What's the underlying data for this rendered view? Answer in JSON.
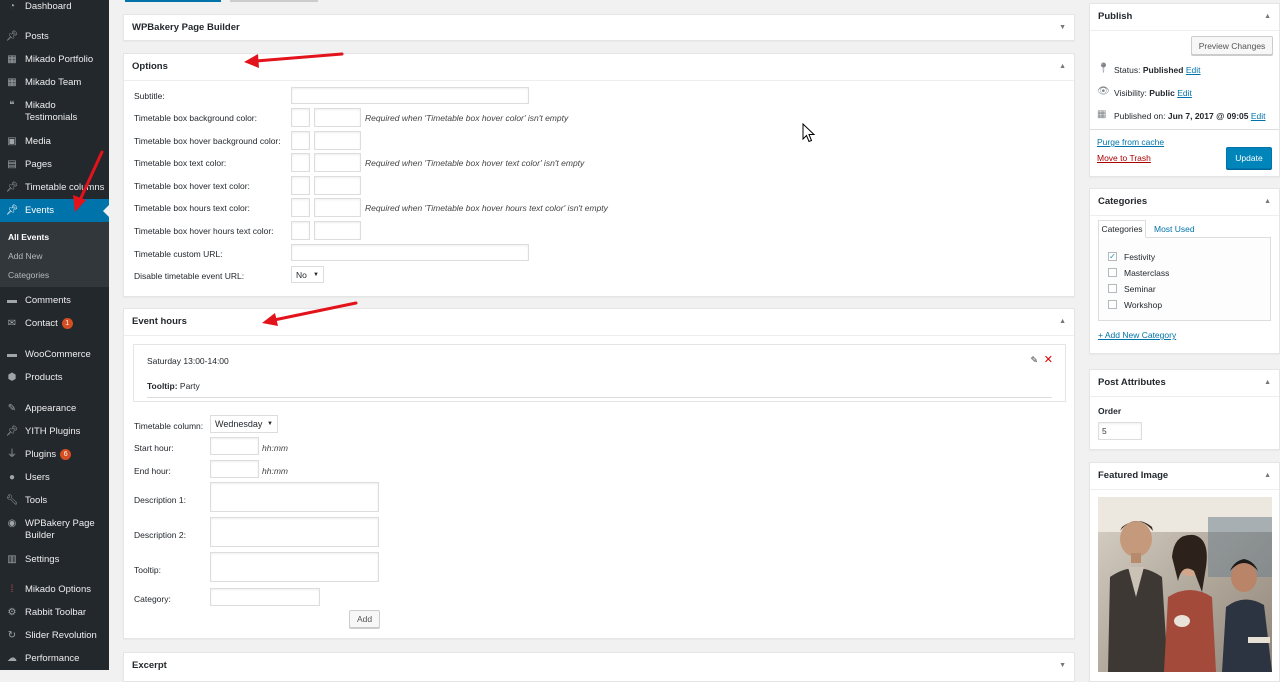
{
  "sidebar": {
    "items": [
      {
        "label": "Dashboard",
        "icon": "dashboard-icon"
      },
      {
        "label": "Posts",
        "icon": "pin-icon"
      },
      {
        "label": "Mikado Portfolio",
        "icon": "grid-icon"
      },
      {
        "label": "Mikado Team",
        "icon": "grid-icon"
      },
      {
        "label": "Mikado Testimonials",
        "icon": "quote-icon"
      },
      {
        "label": "Media",
        "icon": "media-icon"
      },
      {
        "label": "Pages",
        "icon": "page-icon"
      },
      {
        "label": "Timetable columns",
        "icon": "pin-icon"
      },
      {
        "label": "Events",
        "icon": "pin-icon"
      },
      {
        "label": "Comments",
        "icon": "comment-icon"
      },
      {
        "label": "Contact",
        "icon": "mail-icon",
        "badge": "1"
      },
      {
        "label": "WooCommerce",
        "icon": "woo-icon"
      },
      {
        "label": "Products",
        "icon": "box-icon"
      },
      {
        "label": "Appearance",
        "icon": "brush-icon"
      },
      {
        "label": "YITH Plugins",
        "icon": "pin-icon"
      },
      {
        "label": "Plugins",
        "icon": "plug-icon",
        "badge": "6"
      },
      {
        "label": "Users",
        "icon": "user-icon"
      },
      {
        "label": "Tools",
        "icon": "wrench-icon"
      },
      {
        "label": "WPBakery Page Builder",
        "icon": "wpb-icon"
      },
      {
        "label": "Settings",
        "icon": "settings-icon"
      },
      {
        "label": "Mikado Options",
        "icon": "mikado-icon"
      },
      {
        "label": "Rabbit Toolbar",
        "icon": "rabbit-icon"
      },
      {
        "label": "Slider Revolution",
        "icon": "refresh-icon"
      },
      {
        "label": "Performance",
        "icon": "cloud-icon"
      }
    ],
    "submenu": [
      "All Events",
      "Add New",
      "Categories"
    ]
  },
  "wpbakery": {
    "title": "WPBakery Page Builder"
  },
  "options": {
    "title": "Options",
    "rows": {
      "subtitle": "Subtitle:",
      "bg_color": "Timetable box background color:",
      "hover_bg_color": "Timetable box hover background color:",
      "text_color": "Timetable box text color:",
      "hover_text_color": "Timetable box hover text color:",
      "hours_text_color": "Timetable box hours text color:",
      "hover_hours_text_color": "Timetable box hover hours text color:",
      "custom_url": "Timetable custom URL:",
      "disable_url": "Disable timetable event URL:"
    },
    "hints": {
      "bg": "Required when 'Timetable box hover color' isn't empty",
      "text": "Required when 'Timetable box hover text color' isn't empty",
      "hours": "Required when 'Timetable box hover hours text color' isn't empty"
    },
    "disable_url_value": "No"
  },
  "event_hours": {
    "title": "Event hours",
    "entry": {
      "time": "Saturday 13:00-14:00",
      "tooltip_label": "Tooltip:",
      "tooltip_value": "Party"
    },
    "form": {
      "column_label": "Timetable column:",
      "column_value": "Wednesday",
      "start_label": "Start hour:",
      "end_label": "End hour:",
      "hhmm": "hh:mm",
      "desc1_label": "Description 1:",
      "desc2_label": "Description 2:",
      "tooltip_label": "Tooltip:",
      "category_label": "Category:",
      "add_button": "Add"
    }
  },
  "excerpt": {
    "title": "Excerpt"
  },
  "publish": {
    "title": "Publish",
    "preview_button": "Preview Changes",
    "status_label": "Status:",
    "status_value": "Published",
    "visibility_label": "Visibility:",
    "visibility_value": "Public",
    "published_label": "Published on:",
    "published_value": "Jun 7, 2017 @ 09:05",
    "edit": "Edit",
    "purge": "Purge from cache",
    "trash": "Move to Trash",
    "update_button": "Update"
  },
  "categories": {
    "title": "Categories",
    "tabs": [
      "Categories",
      "Most Used"
    ],
    "items": [
      {
        "label": "Festivity",
        "checked": true
      },
      {
        "label": "Masterclass",
        "checked": false
      },
      {
        "label": "Seminar",
        "checked": false
      },
      {
        "label": "Workshop",
        "checked": false
      }
    ],
    "add_new": "+ Add New Category"
  },
  "post_attributes": {
    "title": "Post Attributes",
    "order_label": "Order",
    "order_value": "5"
  },
  "featured_image": {
    "title": "Featured Image"
  },
  "colors": {
    "accent": "#0073aa",
    "sidebar": "#23282d",
    "annotation_arrow": "#e3131b"
  }
}
